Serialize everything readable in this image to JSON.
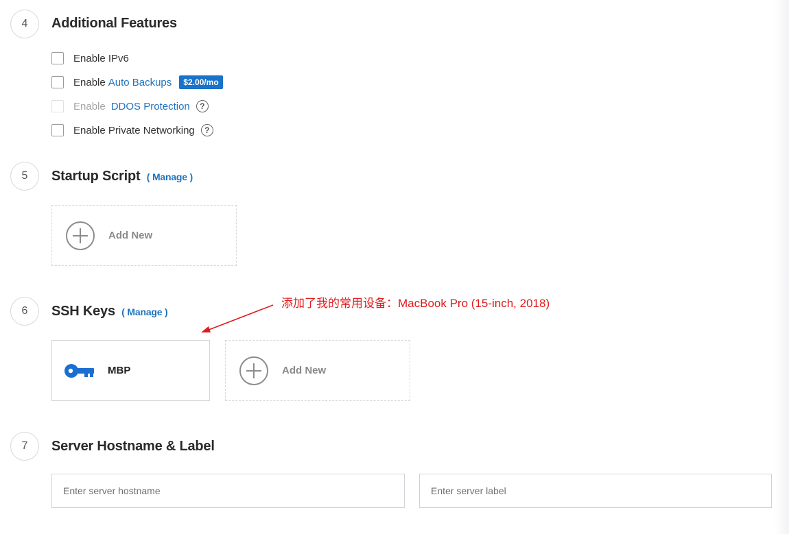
{
  "sections": {
    "features": {
      "number": "4",
      "title": "Additional Features",
      "ipv6": {
        "label": "Enable IPv6"
      },
      "backups": {
        "prefix": "Enable",
        "link": "Auto Backups",
        "price": "$2.00/mo"
      },
      "ddos": {
        "prefix": "Enable",
        "link": "DDOS Protection"
      },
      "private": {
        "label": "Enable Private Networking"
      }
    },
    "startup": {
      "number": "5",
      "title": "Startup Script",
      "manage": "( Manage )",
      "add_new": "Add New"
    },
    "ssh": {
      "number": "6",
      "title": "SSH Keys",
      "manage": "( Manage )",
      "key_name": "MBP",
      "add_new": "Add New"
    },
    "hostname": {
      "number": "7",
      "title": "Server Hostname & Label",
      "hostname_placeholder": "Enter server hostname",
      "label_placeholder": "Enter server label"
    }
  },
  "annotation": {
    "text": "添加了我的常用设备：MacBook Pro (15-inch, 2018)",
    "color": "#e01b1b"
  },
  "colors": {
    "accent": "#1e73be",
    "badge": "#1a72c9",
    "key_icon": "#1a6fd0"
  }
}
